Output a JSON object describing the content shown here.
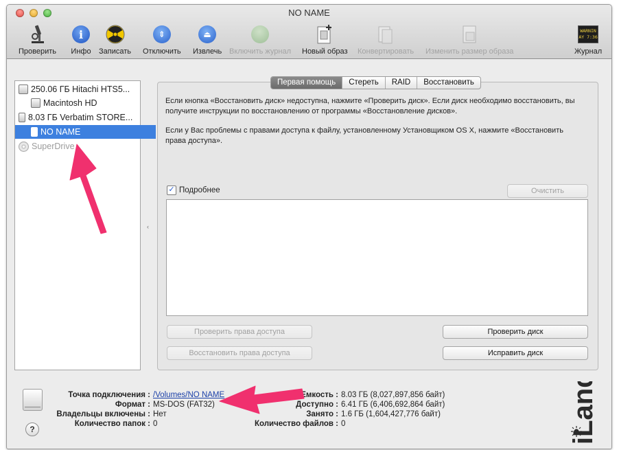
{
  "window": {
    "title": "NO NAME"
  },
  "toolbar": {
    "items": [
      {
        "label": "Проверить",
        "icon": "microscope-icon"
      },
      {
        "label": "Инфо",
        "icon": "info-icon"
      },
      {
        "label": "Записать",
        "icon": "burn-icon"
      },
      {
        "label": "Отключить",
        "icon": "unmount-icon"
      },
      {
        "label": "Извлечь",
        "icon": "eject-icon"
      },
      {
        "label": "Включить журнал",
        "icon": "journal-enable-icon"
      },
      {
        "label": "Новый образ",
        "icon": "new-image-icon"
      },
      {
        "label": "Конвертировать",
        "icon": "convert-icon"
      },
      {
        "label": "Изменить размер образа",
        "icon": "resize-image-icon"
      },
      {
        "label": "Журнал",
        "icon": "log-icon",
        "icon_text": [
          "WARNIN",
          "AY 7:36"
        ]
      }
    ]
  },
  "sidebar": {
    "items": [
      {
        "label": "250.06 ГБ Hitachi HTS5..."
      },
      {
        "label": "Macintosh HD"
      },
      {
        "label": "8.03 ГБ Verbatim STORE..."
      },
      {
        "label": "NO NAME"
      },
      {
        "label": "SuperDrive"
      }
    ]
  },
  "tabs": [
    {
      "label": "Первая помощь"
    },
    {
      "label": "Стереть"
    },
    {
      "label": "RAID"
    },
    {
      "label": "Восстановить"
    }
  ],
  "first_aid": {
    "help_text_1": "Если кнопка «Восстановить диск» недоступна, нажмите «Проверить диск». Если диск необходимо восстановить, вы получите инструкции по восстановлению от программы «Восстановление дисков».",
    "help_text_2": "Если у Вас проблемы с правами доступа к файлу, установленному Установщиком OS X, нажмите «Восстановить права доступа».",
    "details_label": "Подробнее",
    "details_checked": true,
    "clear_label": "Очистить",
    "verify_permissions_label": "Проверить права доступа",
    "repair_permissions_label": "Восстановить права доступа",
    "verify_disk_label": "Проверить диск",
    "repair_disk_label": "Исправить диск"
  },
  "info": {
    "mount_point_label": "Точка подключения :",
    "mount_point_value": "/Volumes/NO NAME",
    "format_label": "Формат :",
    "format_value": "MS-DOS (FAT32)",
    "owners_label": "Владельцы включены :",
    "owners_value": "Нет",
    "folders_label": "Количество папок :",
    "folders_value": "0",
    "capacity_label": "Емкость :",
    "capacity_value": "8.03 ГБ (8,027,897,856 байт)",
    "available_label": "Доступно :",
    "available_value": "6.41 ГБ (6,406,692,864 байт)",
    "used_label": "Занято :",
    "used_value": "1.6 ГБ (1,604,427,776 байт)",
    "files_label": "Количество файлов :",
    "files_value": "0"
  },
  "help_button": {
    "label": "?"
  },
  "brand": {
    "text": "iLand"
  },
  "colors": {
    "selection": "#3d80df",
    "annotation_arrow": "#f0306e"
  }
}
